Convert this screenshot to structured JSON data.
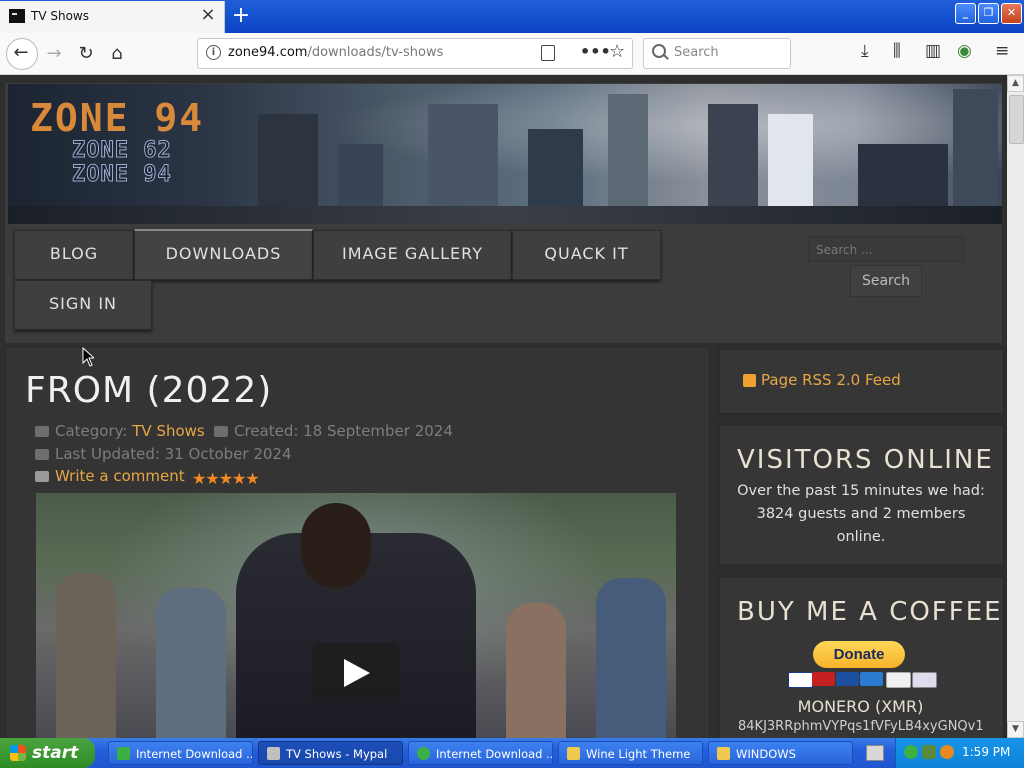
{
  "browser": {
    "tab_title": "TV Shows",
    "url_host": "zone94.com",
    "url_path": "/downloads/tv-shows",
    "search_placeholder": "Search"
  },
  "site": {
    "logo_main": "ZONE 94",
    "logo_sub1": "ZONE 62",
    "logo_sub2": "ZONE 94",
    "nav": [
      "BLOG",
      "DOWNLOADS",
      "IMAGE GALLERY",
      "QUACK IT",
      "SIGN IN"
    ],
    "search_placeholder": "Search ...",
    "search_button": "Search"
  },
  "article": {
    "title": "FROM (2022)",
    "category_label": "Category: ",
    "category": "TV Shows",
    "created": "Created: 18 September 2024",
    "updated": "Last Updated: 31 October 2024",
    "comment": "Write a comment",
    "rating_stars": "★★★★★"
  },
  "sidebar": {
    "rss": "Page RSS 2.0 Feed",
    "visitors_title": "VISITORS ONLINE",
    "visitors_text": "Over the past 15 minutes we had: 3824 guests and 2 members online.",
    "coffee_title": "BUY ME A COFFEE",
    "donate": "Donate",
    "monero_title": "MONERO (XMR)",
    "monero_address": "84KJ3RRphmVYPqs1fVFyLB4xyGNQv1"
  },
  "taskbar": {
    "start": "start",
    "tasks": [
      "Internet Download ...",
      "TV Shows - Mypal",
      "Internet Download ...",
      "Wine Light Theme",
      "WINDOWS"
    ],
    "clock": "1:59 PM"
  }
}
